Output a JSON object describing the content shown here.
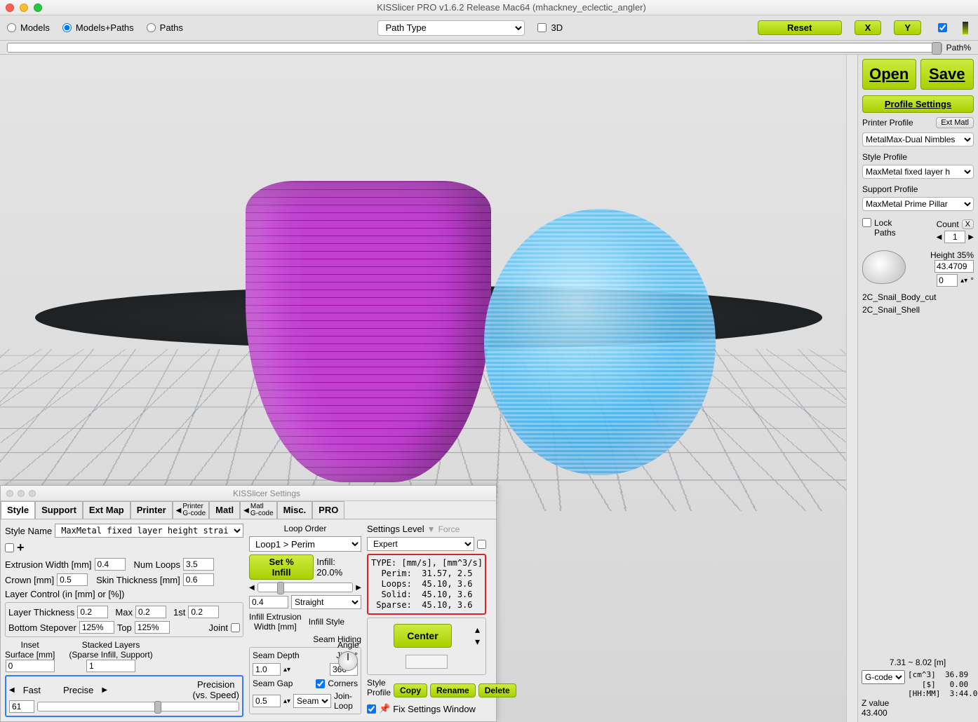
{
  "window": {
    "title": "KISSlicer PRO v1.6.2 Release Mac64 (mhackney_eclectic_angler)"
  },
  "toolbar": {
    "view_modes": {
      "models": "Models",
      "models_paths": "Models+Paths",
      "paths": "Paths"
    },
    "path_type_label": "Path Type",
    "threeD_label": "3D",
    "reset": "Reset",
    "x": "X",
    "y": "Y",
    "path_pct": "Path%",
    "open": "Open",
    "save": "Save"
  },
  "right": {
    "profile_settings": "Profile Settings",
    "printer_profile_label": "Printer Profile",
    "ext_matl": "Ext Matl",
    "printer_profile_value": "MetalMax-Dual Nimbles",
    "style_profile_label": "Style Profile",
    "style_profile_value": "MaxMetal fixed layer h",
    "support_profile_label": "Support Profile",
    "support_profile_value": "MaxMetal Prime Pillar",
    "lock_paths": "Lock\nPaths",
    "count_label": "Count",
    "count_value": "1",
    "close_x": "X",
    "height_label": "Height 35%",
    "height_value": "43.4709",
    "angle_value": "0",
    "degree": "°",
    "model_1": "2C_Snail_Body_cut",
    "model_2": "2C_Snail_Shell",
    "scale_range": "7.31 ~ 8.02 [m]",
    "gcode_label": "G-code",
    "stats": "[cm^3]  36.89\n   [$]   0.00\n[HH:MM]  3:44.0",
    "z_label": "Z value",
    "z_value": "43.400"
  },
  "settings": {
    "title": "KISSlicer Settings",
    "tabs": {
      "style": "Style",
      "support": "Support",
      "ext_map": "Ext Map",
      "printer": "Printer",
      "printer_gcode": "Printer\nG-code",
      "matl": "Matl",
      "matl_gcode": "Matl\nG-code",
      "misc": "Misc.",
      "pro": "PRO"
    },
    "style_name_label": "Style Name",
    "style_name_value": "MaxMetal fixed layer height straight infill",
    "plus": "+",
    "extrusion_width_label": "Extrusion Width [mm]",
    "extrusion_width_value": "0.4",
    "num_loops_label": "Num Loops",
    "num_loops_value": "3.5",
    "crown_label": "Crown [mm]",
    "crown_value": "0.5",
    "skin_label": "Skin Thickness [mm]",
    "skin_value": "0.6",
    "layer_control_label": "Layer Control (in [mm] or [%])",
    "layer_thickness_label": "Layer Thickness",
    "layer_thickness_value": "0.2",
    "max_label": "Max",
    "max_value": "0.2",
    "first_label": "1st",
    "first_value": "0.2",
    "bottom_stepover_label": "Bottom Stepover",
    "bottom_stepover_value": "125%",
    "top_label": "Top",
    "top_value": "125%",
    "joint_label": "Joint",
    "inset_surface_label": "Inset\nSurface [mm]",
    "inset_value": "0",
    "stacked_layers_label": "Stacked Layers\n(Sparse Infill, Support)",
    "stacked_value": "1",
    "fast": "Fast",
    "precise": "Precise",
    "precision_label": "Precision\n(vs. Speed)",
    "precision_value": "61",
    "loop_order_label": "Loop Order",
    "loop_order_value": "Loop1 > Perim",
    "set_infill": "Set % Infill",
    "infill_pct": "Infill: 20.0%",
    "infill_ext_value": "0.4",
    "infill_style_value": "Straight",
    "infill_ext_label": "Infill Extrusion\nWidth [mm]",
    "infill_style_label": "Infill Style",
    "seam_hiding_label": "Seam Hiding",
    "seam_depth_label": "Seam Depth",
    "seam_depth_value": "1.0",
    "jitter_label": "Jitter°",
    "jitter_value": "360",
    "seam_gap_label": "Seam Gap",
    "seam_gap_value": "0.5",
    "corners_label": "Corners",
    "seam_btn": "Seam",
    "join_loop_label": "Join-Loop",
    "angle_label": "Angle",
    "settings_level_label": "Settings Level",
    "force_label": "Force",
    "settings_level_value": "Expert",
    "type_box": "TYPE: [mm/s], [mm^3/s]\n  Perim:  31.57, 2.5\n  Loops:  45.10, 3.6\n  Solid:  45.10, 3.6\n Sparse:  45.10, 3.6",
    "center": "Center",
    "style_profile_label": "Style\nProfile",
    "copy": "Copy",
    "rename": "Rename",
    "delete": "Delete",
    "fix_label": "Fix Settings Window"
  }
}
